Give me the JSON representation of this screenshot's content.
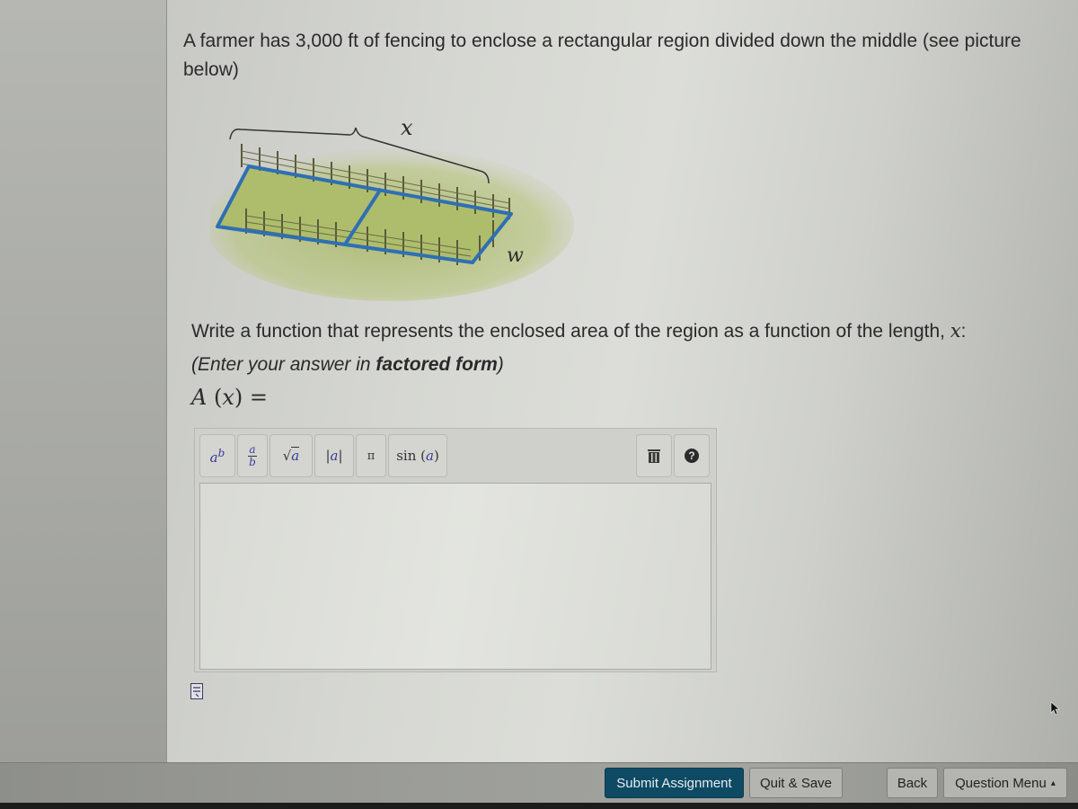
{
  "question": {
    "intro": "A farmer has 3,000 ft of fencing to enclose a rectangular region divided down the middle (see picture below)",
    "figure": {
      "label_length": "x",
      "label_width": "w",
      "description": "Rectangular fenced region divided into two halves"
    },
    "prompt_prefix": "Write a function that represents the enclosed area of the region as a function of the length, ",
    "prompt_var": "x",
    "prompt_suffix": ":",
    "hint_prefix": "(Enter your answer in ",
    "hint_bold": "factored form",
    "hint_suffix": ")",
    "function_name": "A",
    "function_var": "x",
    "function_eq": "="
  },
  "editor": {
    "toolbar": [
      {
        "id": "exponent",
        "label": "a^b",
        "icon": "exponent-icon"
      },
      {
        "id": "fraction",
        "label": "a/b",
        "icon": "fraction-icon"
      },
      {
        "id": "sqrt",
        "label": "√a",
        "icon": "square-root-icon"
      },
      {
        "id": "abs",
        "label": "|a|",
        "icon": "absolute-value-icon"
      },
      {
        "id": "pi",
        "label": "π",
        "icon": "pi-icon"
      },
      {
        "id": "sin",
        "label": "sin (a)",
        "icon": "sine-icon"
      }
    ],
    "trash_icon": "trash-icon",
    "help_icon": "help-icon",
    "help_glyph": "?",
    "answer_value": ""
  },
  "footer": {
    "submit_label": "Submit Assignment",
    "quit_label": "Quit & Save",
    "back_label": "Back",
    "question_menu_label": "Question Menu",
    "question_menu_caret": "▴"
  },
  "colors": {
    "primary_button": "#0e4a63",
    "math_variable": "#3a3a9a",
    "fence_outline": "#2f6fb3",
    "grass": "#a7b869"
  }
}
